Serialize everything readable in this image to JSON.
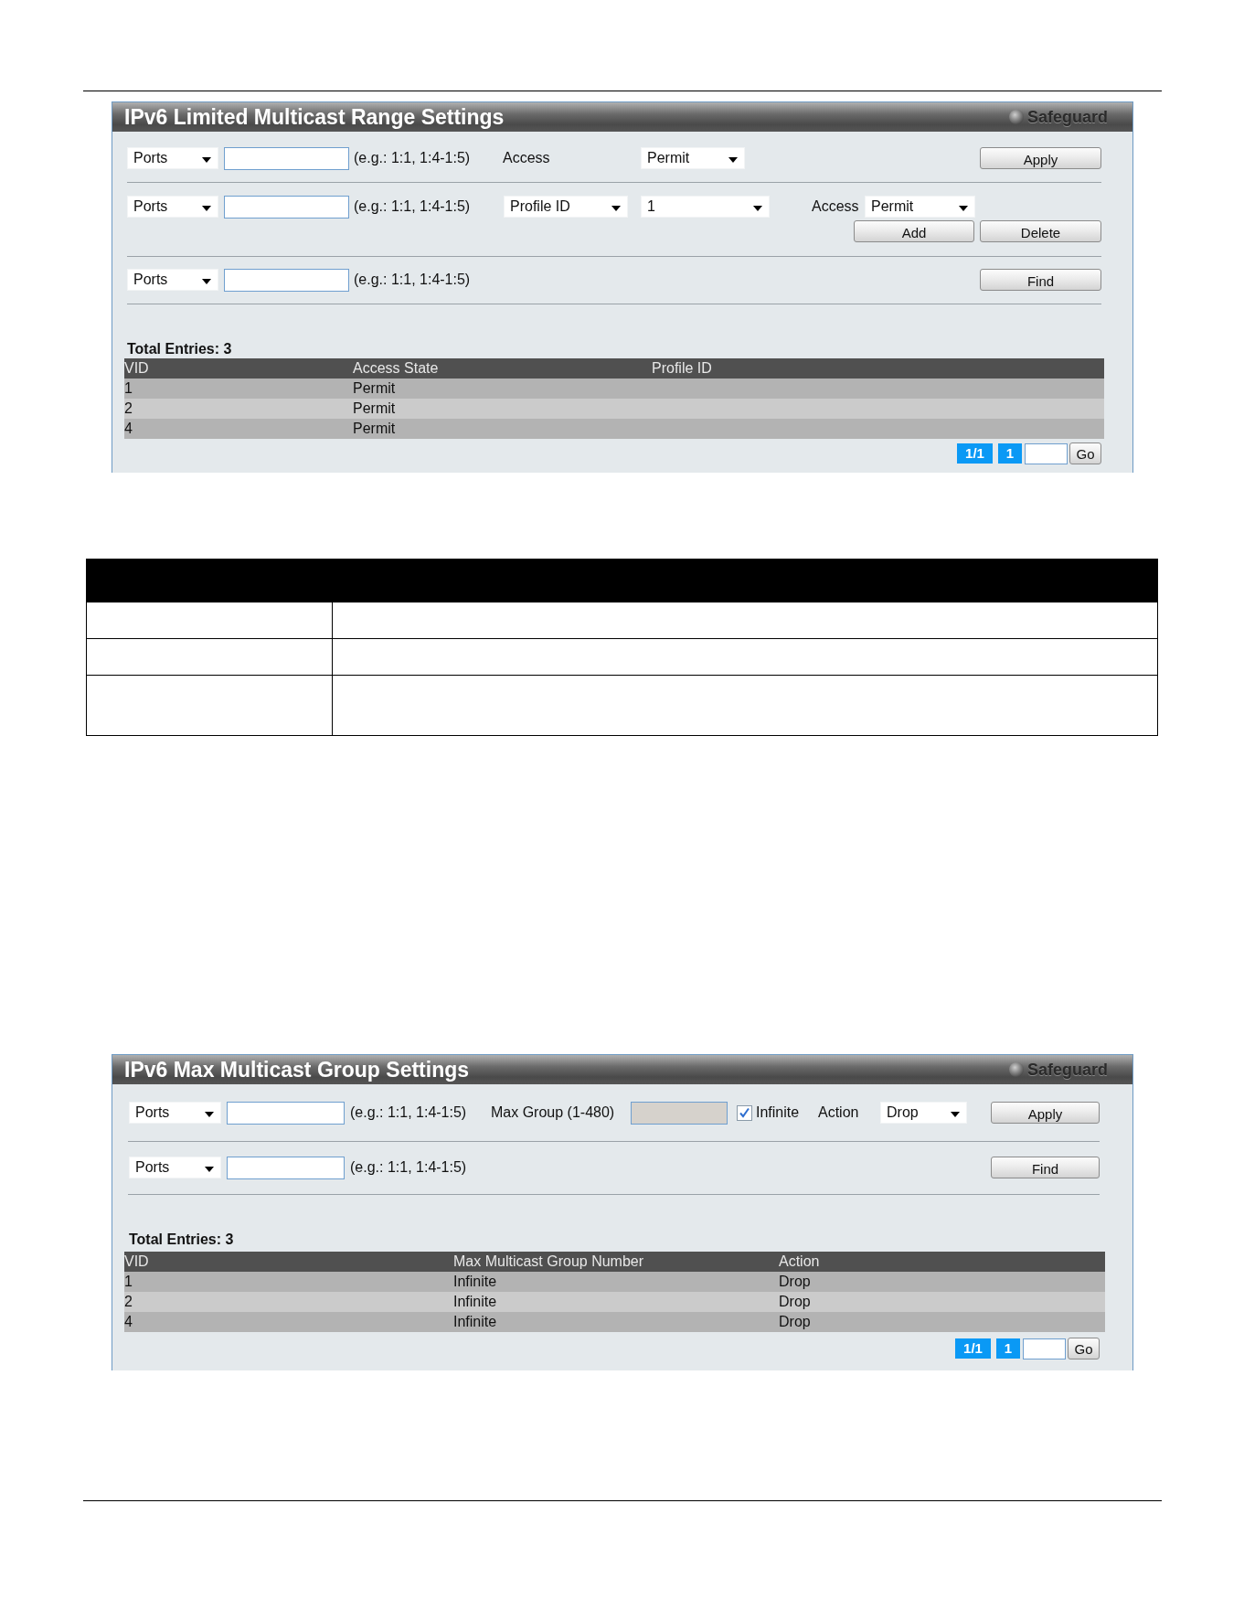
{
  "range_settings": {
    "title": "IPv6 Limited Multicast Range Settings",
    "safeguard": "Safeguard",
    "access_row": {
      "scope_dropdown": "Ports",
      "hint": "(e.g.: 1:1, 1:4-1:5)",
      "access_label": "Access",
      "access_dropdown": "Permit",
      "apply_button": "Apply"
    },
    "profile_row": {
      "scope_dropdown": "Ports",
      "hint": "(e.g.: 1:1, 1:4-1:5)",
      "id_type_dropdown": "Profile ID",
      "profile_dropdown": "1",
      "access_label": "Access",
      "access_dropdown": "Permit",
      "add_button": "Add",
      "delete_button": "Delete"
    },
    "find_row": {
      "scope_dropdown": "Ports",
      "hint": "(e.g.: 1:1, 1:4-1:5)",
      "find_button": "Find"
    },
    "total_entries": "Total Entries: 3",
    "table": {
      "columns": [
        "VID",
        "Access State",
        "Profile ID"
      ],
      "rows": [
        [
          "1",
          "Permit"
        ],
        [
          "2",
          "Permit"
        ],
        [
          "4",
          "Permit"
        ]
      ]
    },
    "pagination": {
      "page_info": "1/1",
      "page_link": "1",
      "go_button": "Go"
    }
  },
  "description_table": {
    "rows": [
      {
        "kind": "single"
      },
      {
        "kind": "single"
      },
      {
        "kind": "tall"
      }
    ]
  },
  "max_group_settings": {
    "title": "IPv6 Max Multicast Group Settings",
    "safeguard": "Safeguard",
    "apply_row": {
      "scope_dropdown": "Ports",
      "hint": "(e.g.: 1:1, 1:4-1:5)",
      "max_group_label": "Max Group (1-480)",
      "max_group_field": {
        "disabled": true
      },
      "infinite_checkbox": {
        "label": "Infinite",
        "checked": true
      },
      "action_label": "Action",
      "action_dropdown": "Drop",
      "apply_button": "Apply"
    },
    "find_row": {
      "scope_dropdown": "Ports",
      "hint": "(e.g.: 1:1, 1:4-1:5)",
      "find_button": "Find"
    },
    "total_entries": "Total Entries: 3",
    "table": {
      "columns": [
        "VID",
        "Max Multicast Group Number",
        "Action"
      ],
      "rows": [
        [
          "1",
          "Infinite",
          "Drop"
        ],
        [
          "2",
          "Infinite",
          "Drop"
        ],
        [
          "4",
          "Infinite",
          "Drop"
        ]
      ]
    },
    "pagination": {
      "page_info": "1/1",
      "page_link": "1",
      "go_button": "Go"
    }
  }
}
